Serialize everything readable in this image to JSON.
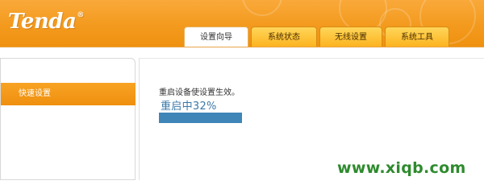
{
  "header": {
    "logo_text": "Tenda",
    "logo_mark": "®",
    "color": "#f39a1e"
  },
  "tabs": [
    {
      "label": "设置向导",
      "active": true
    },
    {
      "label": "系统状态",
      "active": false
    },
    {
      "label": "无线设置",
      "active": false
    },
    {
      "label": "系统工具",
      "active": false
    }
  ],
  "sidebar": {
    "items": [
      {
        "label": "快速设置",
        "selected": true
      }
    ]
  },
  "main": {
    "message": "重启设备使设置生效。",
    "progress_text": "重启中32%",
    "progress_value": 0.32,
    "progress_color": "#3f85b8"
  },
  "watermark": {
    "text": "www.xiqb.com"
  }
}
